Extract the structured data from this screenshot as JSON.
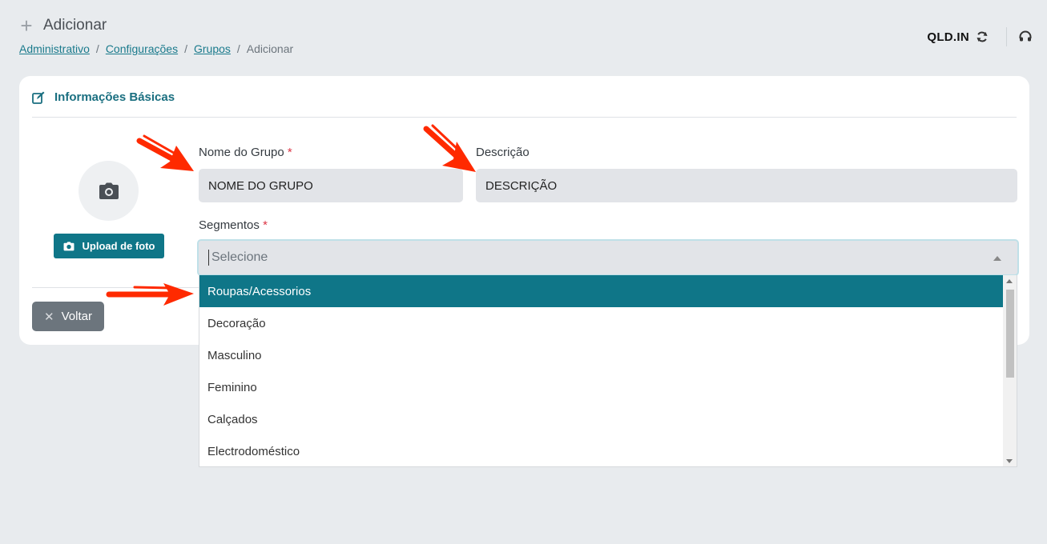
{
  "header": {
    "plus_glyph": "+",
    "title": "Adicionar",
    "breadcrumb": [
      "Administrativo",
      "Configurações",
      "Grupos",
      "Adicionar"
    ],
    "separator": "/"
  },
  "top_right": {
    "store_code": "QLD.IN",
    "refresh_icon": "refresh-icon",
    "support_icon": "headset-icon"
  },
  "card": {
    "title": "Informações Básicas",
    "title_icon": "edit-icon"
  },
  "photo": {
    "upload_label": "Upload de foto",
    "icon": "camera-icon"
  },
  "form": {
    "group_name": {
      "label": "Nome do Grupo",
      "required": "*",
      "value": "NOME DO GRUPO"
    },
    "description": {
      "label": "Descrição",
      "value": "DESCRIÇÃO"
    },
    "segments": {
      "label": "Segmentos",
      "required": "*",
      "placeholder": "Selecione"
    }
  },
  "dropdown": {
    "options": [
      "Roupas/Acessorios",
      "Decoração",
      "Masculino",
      "Feminino",
      "Calçados",
      "Electrodoméstico"
    ],
    "highlighted": "Roupas/Acessorios"
  },
  "actions": {
    "back_label": "Voltar",
    "back_glyph": "✕"
  },
  "colors": {
    "accent": "#0f7688",
    "annotation_arrow": "#ff2a00",
    "required": "#dc3545"
  }
}
